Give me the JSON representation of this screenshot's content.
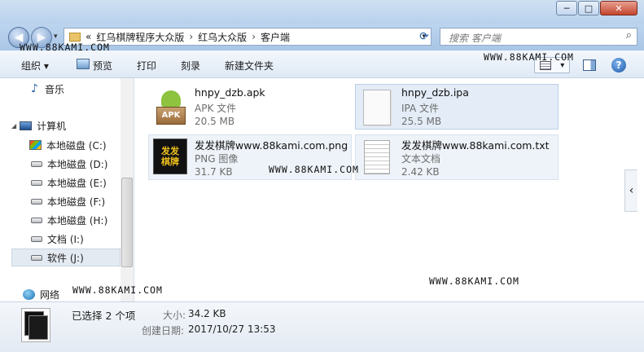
{
  "window": {
    "minimize": "─",
    "maximize": "□",
    "close": "✕"
  },
  "address": {
    "crumbs": [
      "«",
      "红乌棋牌程序大众版",
      "红乌大众版",
      "客户端"
    ],
    "search_placeholder": "搜索 客户端"
  },
  "toolbar": {
    "organize": "组织 ▾",
    "preview": "预览",
    "print": "打印",
    "burn": "刻录",
    "new_folder": "新建文件夹",
    "view_toggle": "▾",
    "help": "?"
  },
  "nav": {
    "music": "音乐",
    "computer": "计算机",
    "drives": [
      "本地磁盘 (C:)",
      "本地磁盘 (D:)",
      "本地磁盘 (E:)",
      "本地磁盘 (F:)",
      "本地磁盘 (H:)",
      "文档 (I:)",
      "软件 (J:)"
    ],
    "network": "网络"
  },
  "files": [
    {
      "name": "hnpy_dzb.apk",
      "type": "APK 文件",
      "size": "20.5 MB",
      "icon_text": "APK"
    },
    {
      "name": "hnpy_dzb.ipa",
      "type": "IPA 文件",
      "size": "25.5 MB"
    },
    {
      "name": "发发棋牌www.88kami.com.png",
      "type": "PNG 图像",
      "size": "31.7 KB",
      "icon_text": "发发棋牌"
    },
    {
      "name": "发发棋牌www.88kami.com.txt",
      "type": "文本文档",
      "size": "2.42 KB"
    }
  ],
  "watermarks": [
    "WWW.88KAMI.COM",
    "WWW.88KAMI.COM",
    "WWW.88KAMI.COM",
    "WWW.88KAMI.COM",
    "WWW.88KAMI.COM"
  ],
  "details": {
    "selected": "已选择 2 个项",
    "size_label": "大小:",
    "size_value": "34.2 KB",
    "date_label": "创建日期:",
    "date_value": "2017/10/27 13:53"
  },
  "colors": {
    "selection": "#e3ecf7",
    "accent": "#2a64a8"
  }
}
